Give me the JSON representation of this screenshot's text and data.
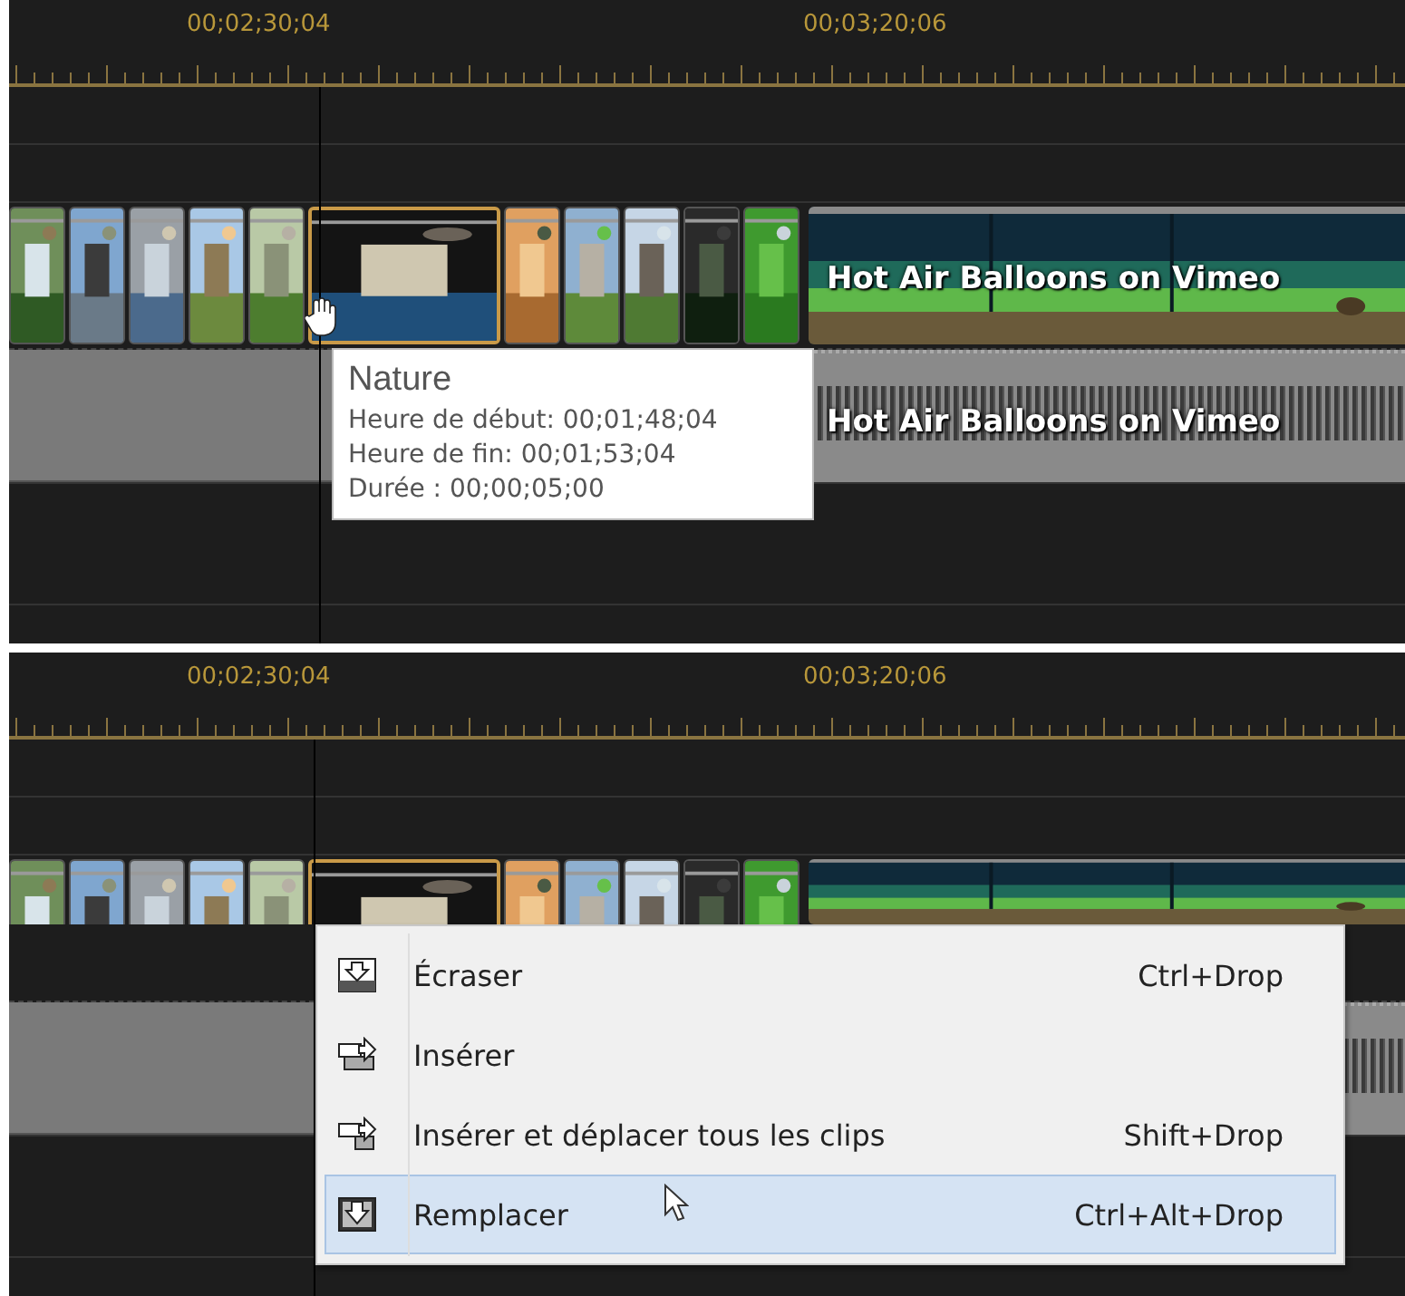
{
  "panels": [
    {
      "ruler": {
        "labels": [
          "00;02;30;04",
          "00;03;20;06"
        ]
      },
      "clips": [
        {
          "kind": "picture",
          "selected": false
        },
        {
          "kind": "picture",
          "selected": false
        },
        {
          "kind": "picture",
          "selected": false
        },
        {
          "kind": "picture",
          "selected": false
        },
        {
          "kind": "picture",
          "selected": false
        },
        {
          "kind": "picture",
          "selected": true
        },
        {
          "kind": "picture",
          "selected": false
        },
        {
          "kind": "picture",
          "selected": false
        },
        {
          "kind": "picture",
          "selected": false
        },
        {
          "kind": "picture",
          "selected": false
        },
        {
          "kind": "picture",
          "selected": false
        }
      ],
      "title_clip": {
        "video_label": "Hot Air Balloons on Vimeo",
        "audio_label": "Hot Air Balloons on Vimeo"
      },
      "tooltip": {
        "title": "Nature",
        "lines": [
          "Heure de début: 00;01;48;04",
          "Heure de fin: 00;01;53;04",
          "Durée : 00;00;05;00"
        ]
      }
    },
    {
      "ruler": {
        "labels": [
          "00;02;30;04",
          "00;03;20;06"
        ]
      },
      "clips": [
        {
          "kind": "picture",
          "selected": false
        },
        {
          "kind": "picture",
          "selected": false
        },
        {
          "kind": "picture",
          "selected": false
        },
        {
          "kind": "picture",
          "selected": false
        },
        {
          "kind": "picture",
          "selected": false
        },
        {
          "kind": "picture",
          "selected": true
        },
        {
          "kind": "picture",
          "selected": false
        },
        {
          "kind": "picture",
          "selected": false
        },
        {
          "kind": "picture",
          "selected": false
        },
        {
          "kind": "picture",
          "selected": false
        },
        {
          "kind": "picture",
          "selected": false
        }
      ],
      "context_menu": {
        "items": [
          {
            "kind": "overwrite",
            "label": "Écraser",
            "shortcut": "Ctrl+Drop",
            "selected": false
          },
          {
            "kind": "insert",
            "label": "Insérer",
            "selected": false
          },
          {
            "kind": "insert_move",
            "label": "Insérer et déplacer tous les clips",
            "shortcut": "Shift+Drop",
            "selected": false
          },
          {
            "kind": "replace",
            "label": "Remplacer",
            "shortcut": "Ctrl+Alt+Drop",
            "selected": true
          }
        ]
      }
    }
  ]
}
